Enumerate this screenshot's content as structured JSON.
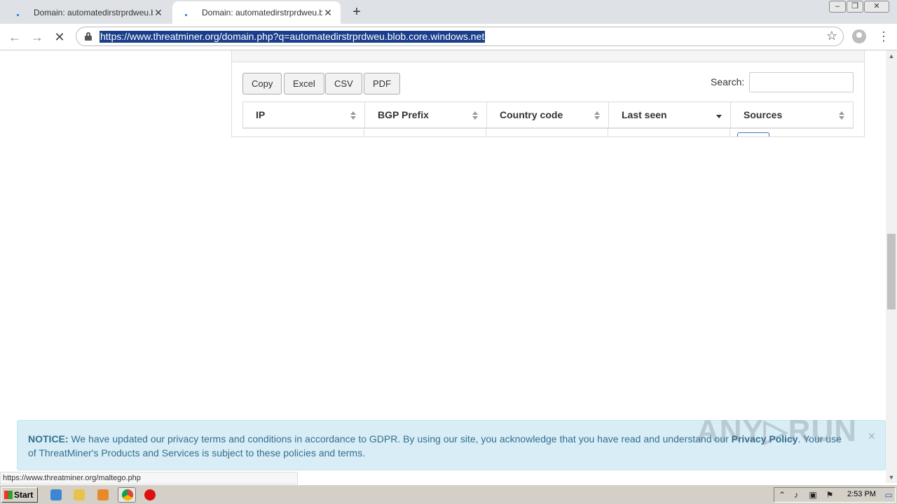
{
  "browser": {
    "tabs": [
      {
        "title": "Domain: automatedirstrprdweu.blob",
        "active": false
      },
      {
        "title": "Domain: automatedirstrprdweu.blob",
        "active": true
      }
    ],
    "new_tab": "+",
    "url": "https://www.threatminer.org/domain.php?q=automatedirstrprdweu.blob.core.windows.net",
    "status_url": "https://www.threatminer.org/maltego.php"
  },
  "table_controls": {
    "buttons": [
      "Copy",
      "Excel",
      "CSV",
      "PDF"
    ],
    "search_label": "Search:",
    "search_value": ""
  },
  "table": {
    "columns": [
      "IP",
      "BGP Prefix",
      "Country code",
      "Last seen",
      "Sources"
    ],
    "sorted_column": "Last seen",
    "sort_direction": "desc"
  },
  "notice": {
    "label": "NOTICE:",
    "text_before": "We have updated our privacy terms and conditions in accordance to GDPR. By using our site, you acknowledge that you have read and understand our",
    "link": "Privacy Policy",
    "text_after": ". Your use of ThreatMiner's Products and Services is subject to these policies and terms.",
    "close": "×"
  },
  "watermark": "ANY▷RUN",
  "taskbar": {
    "start_label": "Start",
    "clock": "2:53 PM"
  }
}
